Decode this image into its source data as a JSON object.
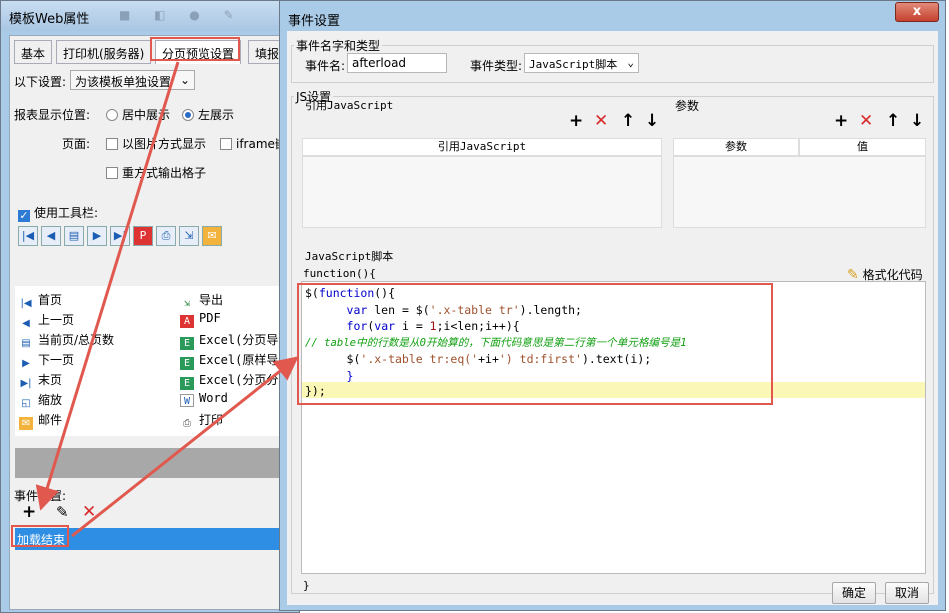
{
  "back": {
    "title": "模板Web属性",
    "tabs": [
      "基本",
      "打印机(服务器)",
      "分页预览设置",
      "填报页"
    ],
    "setting_label": "以下设置:",
    "setting_select": "为该模板单独设置",
    "position_label": "报表显示位置:",
    "position_center": "居中展示",
    "position_left": "左展示",
    "page_label": "页面:",
    "opt_image": "以图片方式显示",
    "opt_iframe": "iframe嵌",
    "opt_repeat": "重方式输出格子",
    "use_toolbar": "使用工具栏:",
    "toolbar_items_left": [
      "首页",
      "上一页",
      "当前页/总页数",
      "下一页",
      "末页",
      "缩放",
      "邮件"
    ],
    "toolbar_items_right": [
      "导出",
      "PDF",
      "Excel(分页导出",
      "Excel(原样导出",
      "Excel(分页分sh",
      "Word",
      "打印"
    ],
    "event_label": "事件设置:",
    "event_item": "加载结束"
  },
  "front": {
    "title": "事件设置",
    "close": "x",
    "group_name": "事件名字和类型",
    "event_name_label": "事件名:",
    "event_name_value": "afterload",
    "event_type_label": "事件类型:",
    "event_type_value": "JavaScript脚本",
    "js_group": "JS设置",
    "ref_js_label": "引用JavaScript",
    "ref_js_header": "引用JavaScript",
    "params_label": "参数",
    "params_header_name": "参数",
    "params_header_value": "值",
    "script_label": "JavaScript脚本",
    "func_open": "function(){",
    "format_code": "格式化代码",
    "func_close": "}",
    "ok": "确定",
    "cancel": "取消",
    "code": {
      "l1a": "$(",
      "l1b": "function",
      "l1c": "(){",
      "l2a": "      ",
      "l2b": "var",
      "l2c": " len = $(",
      "l2d": "'.x-table tr'",
      "l2e": ").length;",
      "l3a": "      ",
      "l3b": "for",
      "l3c": "(",
      "l3d": "var",
      "l3e": " i = ",
      "l3f": "1",
      "l3g": ";i<len;i++){",
      "l4": "// table中的行数是从0开始算的，下面代码意思是第二行第一个单元格编号是1",
      "l5a": "      $(",
      "l5b": "'.x-table tr:eq('",
      "l5c": "+i+",
      "l5d": "') td:first'",
      "l5e": ").text(i);",
      "l6": "      }",
      "l7": "});"
    }
  }
}
